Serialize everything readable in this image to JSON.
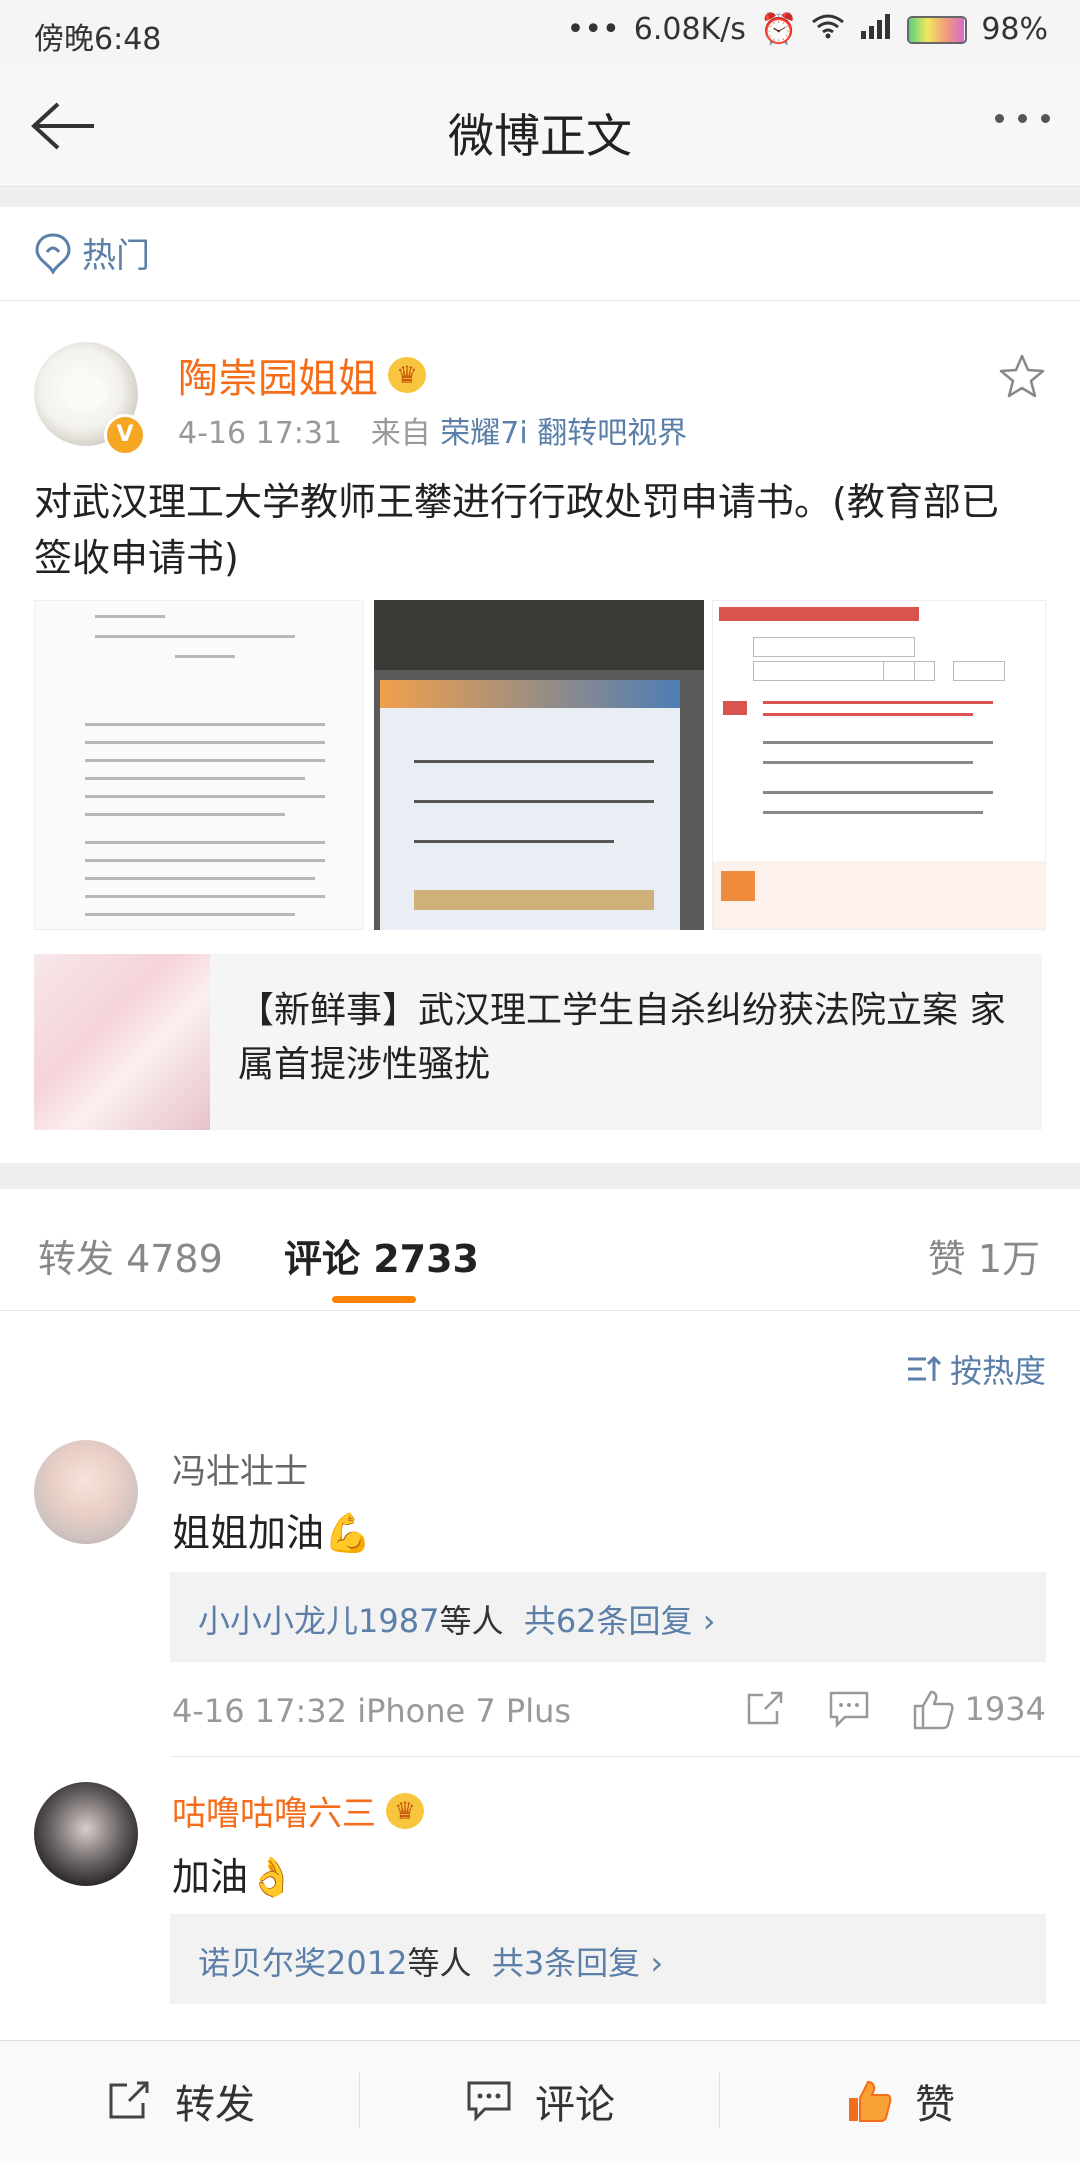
{
  "status_bar": {
    "time": "傍晚6:48",
    "speed": "6.08K/s",
    "battery": "98%",
    "battery_level": 0.98
  },
  "nav": {
    "title": "微博正文"
  },
  "hot_tag": {
    "label": "热门"
  },
  "post": {
    "author": "陶崇园姐姐",
    "time": "4-16 17:31",
    "from_prefix": "来自",
    "source": "荣耀7i 翻转吧视界",
    "text": "对武汉理工大学教师王攀进行行政处罚申请书。(教育部已签收申请书)",
    "link_card": {
      "title": "【新鲜事】武汉理工学生自杀纠纷获法院立案 家属首提涉性骚扰"
    }
  },
  "tabs": {
    "repost": "转发 4789",
    "comment": "评论 2733",
    "like": "赞 1万"
  },
  "sort": {
    "label": "按热度"
  },
  "comments": [
    {
      "name": "冯壮壮士",
      "text": "姐姐加油💪",
      "reply_user": "小小小龙儿1987",
      "reply_mid": "等人",
      "reply_count": "共62条回复",
      "time_device": "4-16 17:32  iPhone 7 Plus",
      "likes": "1934"
    },
    {
      "name": "咕噜咕噜六三",
      "text": "加油👌",
      "reply_user": "诺贝尔奖2012",
      "reply_mid": "等人",
      "reply_count": "共3条回复"
    }
  ],
  "bottom_bar": {
    "repost": "转发",
    "comment": "评论",
    "like": "赞"
  },
  "colors": {
    "accent": "#ff8200",
    "link": "#5b7fa8",
    "username_vip": "#f46d1a"
  }
}
